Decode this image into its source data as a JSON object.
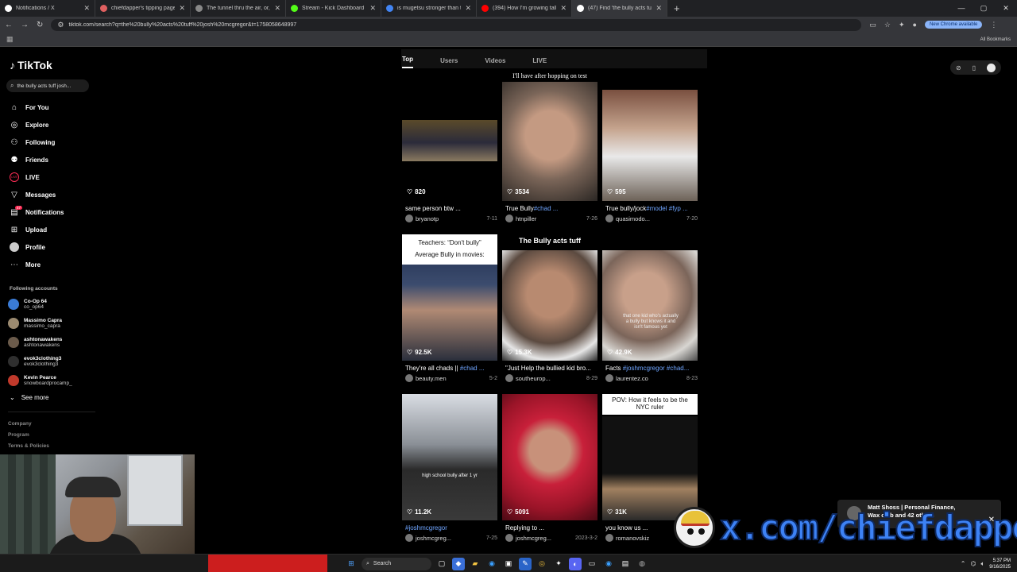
{
  "browser": {
    "tabs": [
      {
        "title": "Notifications / X",
        "fav": "#ffffff"
      },
      {
        "title": "chiefdapper's tipping page",
        "fav": "#e06060"
      },
      {
        "title": "The tunnel thru the air, or, Look",
        "fav": "#888888"
      },
      {
        "title": "Stream - Kick Dashboard",
        "fav": "#53fc18"
      },
      {
        "title": "is mugetsu stronger than true",
        "fav": "#4285f4"
      },
      {
        "title": "(394) How I'm growing taller at",
        "fav": "#ff0000"
      },
      {
        "title": "(47) Find 'the bully acts tuff josh",
        "fav": "#ffffff"
      }
    ],
    "url": "tiktok.com/search?q=the%20bully%20acts%20tuff%20josh%20mcgregor&t=1758058648997",
    "update_pill": "New Chrome available",
    "all_bookmarks": "All Bookmarks"
  },
  "tiktok": {
    "logo": "TikTok",
    "search_query": "the bully acts tuff josh...",
    "nav": [
      {
        "label": "For You"
      },
      {
        "label": "Explore"
      },
      {
        "label": "Following"
      },
      {
        "label": "Friends"
      },
      {
        "label": "LIVE"
      },
      {
        "label": "Messages"
      },
      {
        "label": "Notifications",
        "badge": "47"
      },
      {
        "label": "Upload"
      },
      {
        "label": "Profile"
      },
      {
        "label": "More"
      }
    ],
    "following_header": "Following accounts",
    "accounts": [
      {
        "name": "Co-Op 64",
        "handle": "co_op64",
        "color": "#3a7bd5"
      },
      {
        "name": "Massimo Capra",
        "handle": "massimo_capra",
        "color": "#9b8a70"
      },
      {
        "name": "ashtonawakens",
        "handle": "ashtonawakens",
        "color": "#6b5b4b"
      },
      {
        "name": "evok3clothing3",
        "handle": "evok3clothing3",
        "color": "#2f2f2f"
      },
      {
        "name": "Kevin Pearce",
        "handle": "snowboardprocamp_",
        "color": "#c0392b"
      }
    ],
    "see_more": "See more",
    "footer": [
      "Company",
      "Program",
      "Terms & Policies"
    ],
    "result_tabs": [
      "Top",
      "Users",
      "Videos",
      "LIVE"
    ],
    "results": [
      {
        "likes": "820",
        "caption": "same person btw ...",
        "tag": "",
        "creator": "bryanotp",
        "date": "7-11"
      },
      {
        "likes": "3534",
        "caption": "True Bully",
        "tag": "#chad ...",
        "creator": "htnpiller",
        "date": "7-26",
        "overlay": "I'll have after hopping on test"
      },
      {
        "likes": "595",
        "caption": "True bully/jock",
        "tag": "#model #fyp ...",
        "creator": "quasimodo...",
        "date": "7-20"
      },
      {
        "likes": "92.5K",
        "caption": "They're all chads || ",
        "tag": "#chad ...",
        "creator": "beauty.men",
        "date": "5-2",
        "box1": "Teachers: “Don't bully”",
        "box2": "Average Bully in movies:"
      },
      {
        "likes": "15.3K",
        "caption": "\"Just Help the bullied kid bro...",
        "tag": "",
        "creator": "southeurop...",
        "date": "8-29",
        "title_overlay": "The Bully acts tuff"
      },
      {
        "likes": "42.9K",
        "caption": "Facts ",
        "tag": "#joshmcgregor #chad...",
        "creator": "laurentez.co",
        "date": "8-23",
        "small_overlay": "that one kid who's actually a bully but knows it and isn't famous yet"
      },
      {
        "likes": "11.2K",
        "caption": "",
        "tag": "#joshmcgregor",
        "creator": "joshmcgreg...",
        "date": "7-25",
        "small_overlay": "high school bully after 1 yr"
      },
      {
        "likes": "5091",
        "caption": "Replying to ...",
        "tag": "",
        "creator": "joshmcgreg...",
        "date": "2023-3-2"
      },
      {
        "likes": "31K",
        "caption": "you know us ...",
        "tag": "",
        "creator": "romanovskiz",
        "date": "",
        "box1": "POV: How it feels to be the NYC ruler"
      }
    ]
  },
  "notification": {
    "title": "Matt Shoss | Personal Finance,",
    "line2": "Wax club and 42 others"
  },
  "watermark": "x.com/chiefdapper",
  "taskbar": {
    "search": "Search",
    "time": "5:37 PM",
    "date": "9/16/2025"
  },
  "colors": {
    "tiktok_accent": "#fe2c55",
    "hashtag": "#6fa5ff",
    "watermark_blue": "#3d82f5",
    "taskbar_red": "#cc1e1e"
  }
}
